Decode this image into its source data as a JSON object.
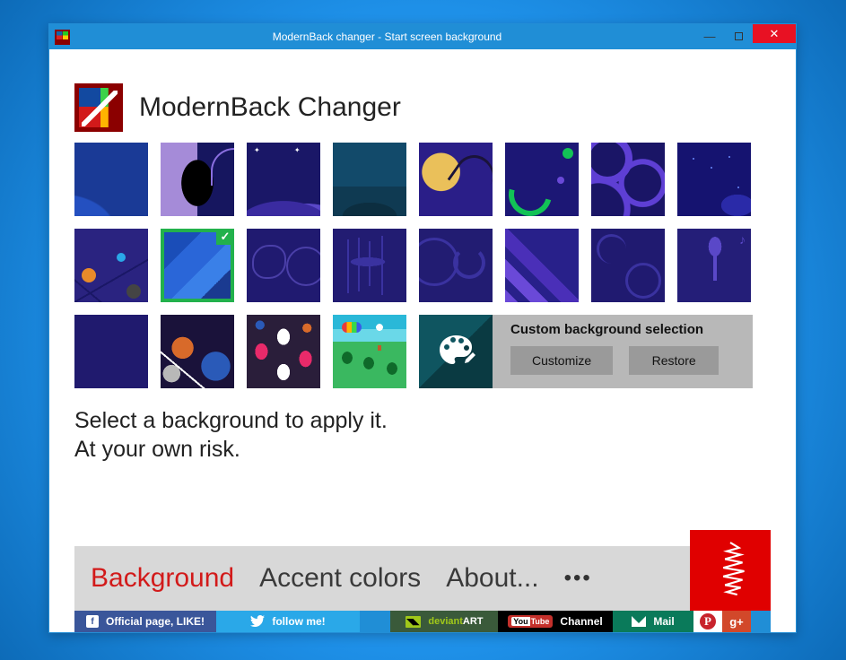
{
  "titlebar": {
    "title": "ModernBack changer - Start screen background"
  },
  "header": {
    "app_name": "ModernBack Changer"
  },
  "custom_panel": {
    "title": "Custom background selection",
    "customize_label": "Customize",
    "restore_label": "Restore"
  },
  "hint": {
    "line1": "Select a background to apply it.",
    "line2": "At your own risk."
  },
  "tabs": {
    "background": "Background",
    "accent": "Accent colors",
    "about": "About...",
    "more": "•••"
  },
  "social": {
    "fb": "Official page, LIKE!",
    "tw": "follow me!",
    "da_logo": "◥◣",
    "da_prefix": "deviant",
    "da_suffix": "ART",
    "yt_badge": "Tube",
    "yt": "Channel",
    "mail": "Mail",
    "pin": "P",
    "gp": "g+"
  },
  "icons": {
    "facebook_f": "f"
  }
}
